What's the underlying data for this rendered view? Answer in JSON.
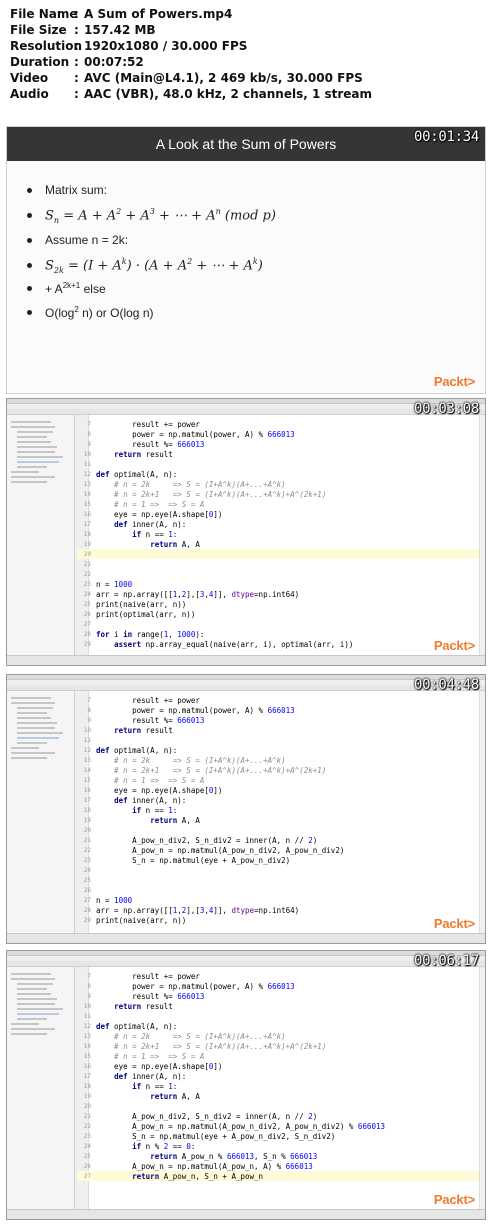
{
  "file_info": [
    {
      "key": "File Name",
      "sep": ":",
      "value": "A Sum of Powers.mp4"
    },
    {
      "key": "File Size",
      "sep": ":",
      "value": "157.42 MB"
    },
    {
      "key": "Resolution",
      "sep": ":",
      "value": "1920x1080 / 30.000 FPS"
    },
    {
      "key": "Duration",
      "sep": ":",
      "value": "00:07:52"
    },
    {
      "key": "Video",
      "sep": ":",
      "value": "AVC (Main@L4.1), 2 469 kb/s, 30.000 FPS"
    },
    {
      "key": "Audio",
      "sep": ":",
      "value": "AAC (VBR), 48.0 kHz, 2 channels, 1 stream"
    }
  ],
  "brand": "Packt>",
  "frames": [
    {
      "timestamp": "00:01:34",
      "slide_title": "A Look at the Sum of Powers",
      "bullets": {
        "b1": "Matrix sum:",
        "b2": "S",
        "b2_sub": "n",
        "b2_rest": " = A + A",
        "b2_e1": "2",
        "b2_rest2": " + A",
        "b2_e2": "3",
        "b2_rest3": " + ⋯ + A",
        "b2_e3": "n",
        "b2_rest4": "  (mod p)",
        "b3": "Assume n = 2k:",
        "b4": "S",
        "b4_sub": "2k",
        "b4_rest": " = (I + A",
        "b4_e1": "k",
        "b4_rest2": ") · (A + A",
        "b4_e2": "2",
        "b4_rest3": " + ⋯ + A",
        "b4_e3": "k",
        "b4_rest4": ")",
        "b5": "+ A",
        "b5_sup": "2k+1",
        "b5_rest": " else",
        "b6": "O(log",
        "b6_sup": "2",
        "b6_rest": " n) or O(log n)"
      }
    },
    {
      "timestamp": "00:03:08",
      "lines": [
        {
          "n": "7",
          "t": "        result += power"
        },
        {
          "n": "8",
          "t": "        power = np.matmul(power, A) % 666013"
        },
        {
          "n": "9",
          "t": "        result %= 666013"
        },
        {
          "n": "10",
          "t": "    return result"
        },
        {
          "n": "11",
          "t": ""
        },
        {
          "n": "12",
          "t": "def optimal(A, n):"
        },
        {
          "n": "13",
          "t": "    # n = 2k     => S = (I+A^k)(A+...+A^k)"
        },
        {
          "n": "14",
          "t": "    # n = 2k+1   => S = (I+A^k)(A+...+A^k)+A^(2k+1)"
        },
        {
          "n": "15",
          "t": "    # n = 1 =>  => S = A"
        },
        {
          "n": "16",
          "t": "    eye = np.eye(A.shape[0])"
        },
        {
          "n": "17",
          "t": "    def inner(A, n):"
        },
        {
          "n": "18",
          "t": "        if n == 1:"
        },
        {
          "n": "19",
          "t": "            return A, A"
        },
        {
          "n": "20",
          "t": ""
        },
        {
          "n": "21",
          "t": ""
        },
        {
          "n": "22",
          "t": ""
        },
        {
          "n": "23",
          "t": "n = 1000"
        },
        {
          "n": "24",
          "t": "arr = np.array([[1,2],[3,4]], dtype=np.int64)"
        },
        {
          "n": "25",
          "t": "print(naive(arr, n))"
        },
        {
          "n": "26",
          "t": "print(optimal(arr, n))"
        },
        {
          "n": "27",
          "t": ""
        },
        {
          "n": "28",
          "t": "for i in range(1, 1000):"
        },
        {
          "n": "29",
          "t": "    assert np.array_equal(naive(arr, i), optimal(arr, i))"
        }
      ]
    },
    {
      "timestamp": "00:04:48",
      "lines": [
        {
          "n": "7",
          "t": "        result += power"
        },
        {
          "n": "8",
          "t": "        power = np.matmul(power, A) % 666013"
        },
        {
          "n": "9",
          "t": "        result %= 666013"
        },
        {
          "n": "10",
          "t": "    return result"
        },
        {
          "n": "11",
          "t": ""
        },
        {
          "n": "12",
          "t": "def optimal(A, n):"
        },
        {
          "n": "13",
          "t": "    # n = 2k     => S = (I+A^k)(A+...+A^k)"
        },
        {
          "n": "14",
          "t": "    # n = 2k+1   => S = (I+A^k)(A+...+A^k)+A^(2k+1)"
        },
        {
          "n": "15",
          "t": "    # n = 1 =>  => S = A"
        },
        {
          "n": "16",
          "t": "    eye = np.eye(A.shape[0])"
        },
        {
          "n": "17",
          "t": "    def inner(A, n):"
        },
        {
          "n": "18",
          "t": "        if n == 1:"
        },
        {
          "n": "19",
          "t": "            return A, A"
        },
        {
          "n": "20",
          "t": ""
        },
        {
          "n": "21",
          "t": "        A_pow_n_div2, S_n_div2 = inner(A, n // 2)"
        },
        {
          "n": "22",
          "t": "        A_pow_n = np.matmul(A_pow_n_div2, A_pow_n_div2)"
        },
        {
          "n": "23",
          "t": "        S_n = np.matmul(eye + A_pow_n_div2)"
        },
        {
          "n": "24",
          "t": ""
        },
        {
          "n": "25",
          "t": ""
        },
        {
          "n": "26",
          "t": ""
        },
        {
          "n": "27",
          "t": "n = 1000"
        },
        {
          "n": "28",
          "t": "arr = np.array([[1,2],[3,4]], dtype=np.int64)"
        },
        {
          "n": "29",
          "t": "print(naive(arr, n))"
        }
      ]
    },
    {
      "timestamp": "00:06:17",
      "lines": [
        {
          "n": "7",
          "t": "        result += power"
        },
        {
          "n": "8",
          "t": "        power = np.matmul(power, A) % 666013"
        },
        {
          "n": "9",
          "t": "        result %= 666013"
        },
        {
          "n": "10",
          "t": "    return result"
        },
        {
          "n": "11",
          "t": ""
        },
        {
          "n": "12",
          "t": "def optimal(A, n):"
        },
        {
          "n": "13",
          "t": "    # n = 2k     => S = (I+A^k)(A+...+A^k)"
        },
        {
          "n": "14",
          "t": "    # n = 2k+1   => S = (I+A^k)(A+...+A^k)+A^(2k+1)"
        },
        {
          "n": "15",
          "t": "    # n = 1 =>  => S = A"
        },
        {
          "n": "16",
          "t": "    eye = np.eye(A.shape[0])"
        },
        {
          "n": "17",
          "t": "    def inner(A, n):"
        },
        {
          "n": "18",
          "t": "        if n == 1:"
        },
        {
          "n": "19",
          "t": "            return A, A"
        },
        {
          "n": "20",
          "t": ""
        },
        {
          "n": "21",
          "t": "        A_pow_n_div2, S_n_div2 = inner(A, n // 2)"
        },
        {
          "n": "22",
          "t": "        A_pow_n = np.matmul(A_pow_n_div2, A_pow_n_div2) % 666013"
        },
        {
          "n": "23",
          "t": "        S_n = np.matmul(eye + A_pow_n_div2, S_n_div2)"
        },
        {
          "n": "24",
          "t": "        if n % 2 == 0:"
        },
        {
          "n": "25",
          "t": "            return A_pow_n % 666013, S_n % 666013"
        },
        {
          "n": "26",
          "t": "        A_pow_n = np.matmul(A_pow_n, A) % 666013"
        },
        {
          "n": "27",
          "t": "        return A_pow_n, S_n + A_pow_n"
        }
      ]
    }
  ],
  "colors": {
    "slide_title_bar": "#353535",
    "brand": "#ef7a2c",
    "keyword": "#000080",
    "number": "#0000ff",
    "comment": "#8c8c8c",
    "current_line": "#fffbd6"
  }
}
